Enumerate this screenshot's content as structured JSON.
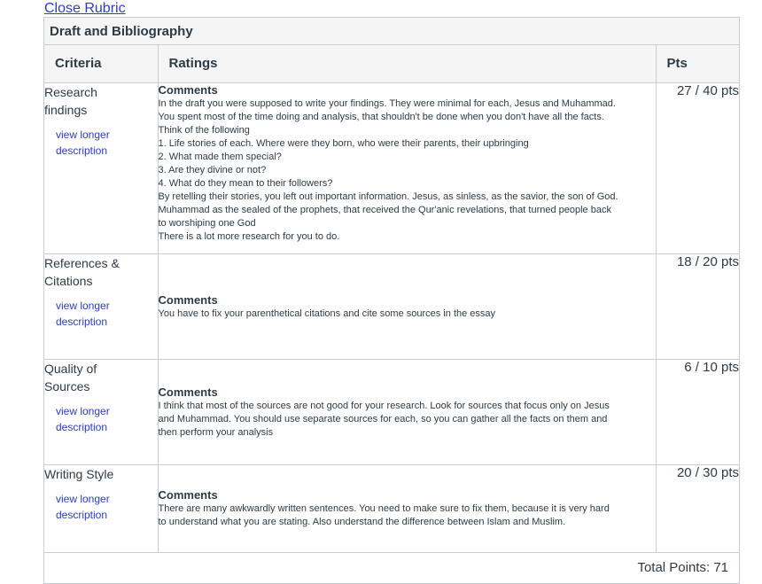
{
  "close_link": "Close Rubric",
  "rubric": {
    "title": "Draft and Bibliography",
    "headers": {
      "criteria": "Criteria",
      "ratings": "Ratings",
      "pts": "Pts"
    },
    "view_longer": "view longer",
    "description": "description",
    "comments_label": "Comments",
    "rows": [
      {
        "criteria_lines": [
          "Research",
          "findings"
        ],
        "comment_lines": [
          "In the draft you were supposed to write your findings. They were minimal for each, Jesus and Muhammad.",
          "You spent most of the time doing and analysis, that shouldn't be done when you don't have all the facts.",
          "Think of the following",
          "1. Life stories of each. Where were they born, who were their parents, their upbringing",
          "2. What made them special?",
          "3. Are they divine or not?",
          "4. What do they mean to their followers?",
          "By retelling their stories, you left out important information. Jesus, as sinless, as the savior, the son of God.",
          "Muhammad as the sealed of the prophets, that received the Qur'anic revelations, that turned people back",
          "to worshiping one God",
          "There is a lot more research for you to do."
        ],
        "pts": "27 / 40 pts"
      },
      {
        "criteria_lines": [
          "References &",
          "Citations"
        ],
        "comment_lines": [
          "You have to fix your parenthetical citations and cite some sources in the essay"
        ],
        "pts": "18 / 20 pts"
      },
      {
        "criteria_lines": [
          "Quality of",
          "Sources"
        ],
        "comment_lines": [
          "I think that most of the sources are not good for your research. Look for sources that focus only on Jesus",
          "and Muhammad. You should use separate sources for each, so you can gather all the facts on them and",
          "then perform your analysis"
        ],
        "pts": "6 / 10 pts"
      },
      {
        "criteria_lines": [
          "Writing Style"
        ],
        "comment_lines": [
          "There are many awkwardly written sentences. You need to make sure to fix them, because it is very hard",
          "to understand what you are stating. Also understand the difference between Islam and Muslim."
        ],
        "pts": "20 / 30 pts"
      }
    ],
    "total": "Total Points: 71"
  }
}
